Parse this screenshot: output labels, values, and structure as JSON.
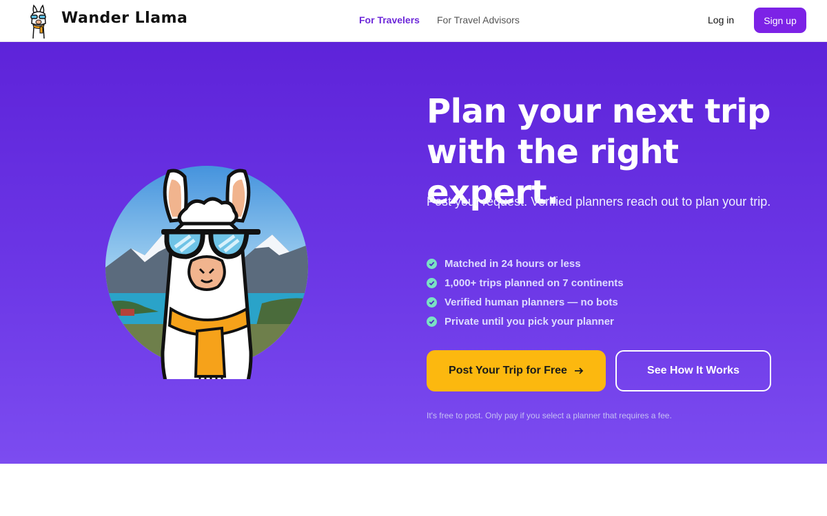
{
  "header": {
    "brand": "Wander Llama",
    "nav": [
      {
        "label": "For Travelers",
        "active": true
      },
      {
        "label": "For Travel Advisors",
        "active": false
      }
    ],
    "login_label": "Log in",
    "signup_label": "Sign up"
  },
  "hero": {
    "headline_line1": "Plan your next trip",
    "headline_line2": "with the right expert.",
    "subheadline": "Post your request. Verified planners reach out to plan your trip.",
    "features": [
      "Matched in 24 hours or less",
      "1,000+ trips planned on 7 continents",
      "Verified human planners — no bots",
      "Private until you pick your planner"
    ],
    "primary_cta": "Post Your Trip for Free",
    "primary_cta_icon": "arrow-right-icon",
    "secondary_cta": "See How It Works",
    "disclaimer": "It's free to post. Only pay if you select a planner that requires a fee."
  },
  "colors": {
    "brand_purple": "#7c22e6",
    "hero_gradient_top": "#5e23d9",
    "hero_gradient_bottom": "#7c4cf0",
    "cta_yellow": "#fcb80f",
    "check_green": "#7ae1c4"
  }
}
